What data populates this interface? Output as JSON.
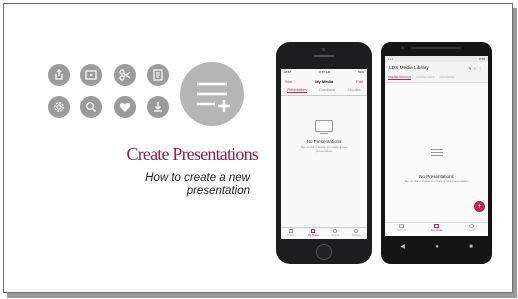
{
  "slide": {
    "title": "Create Presentations",
    "subtitle": "How to create a new presentation"
  },
  "icons": [
    {
      "name": "share-icon"
    },
    {
      "name": "video-icon"
    },
    {
      "name": "scissors-icon"
    },
    {
      "name": "document-icon"
    },
    {
      "name": "settings-icon"
    },
    {
      "name": "search-icon"
    },
    {
      "name": "heart-icon"
    },
    {
      "name": "download-icon"
    },
    {
      "name": "add-presentation-icon"
    }
  ],
  "iphone": {
    "status_left": "AT&T",
    "status_time": "8:57 AM",
    "status_right": "81%",
    "nav_left": "Sort",
    "nav_title": "My Media",
    "nav_right": "Edit",
    "tabs": [
      "Presentations",
      "Downloads",
      "Favorites"
    ],
    "empty_title": "No Presentations",
    "empty_sub": "Tap on the + button to create a new presentation",
    "bottom_tabs": [
      "Browse",
      "My Media",
      "Search",
      "Settings"
    ]
  },
  "android": {
    "status_right": "8:58",
    "title": "LDS Media Library",
    "tabs": [
      "PRESENTATIONS",
      "DOWNLOADS",
      "FAVORITES"
    ],
    "empty_title": "No Presentations",
    "empty_sub": "Tap on the + button to create a new presentation",
    "fab": "+",
    "bottom_tabs": [
      "Browse",
      "My Media",
      "Search"
    ]
  },
  "colors": {
    "accent": "#c41e5a",
    "title": "#8e1f4c",
    "icon_bg": "#9b9b9b"
  }
}
